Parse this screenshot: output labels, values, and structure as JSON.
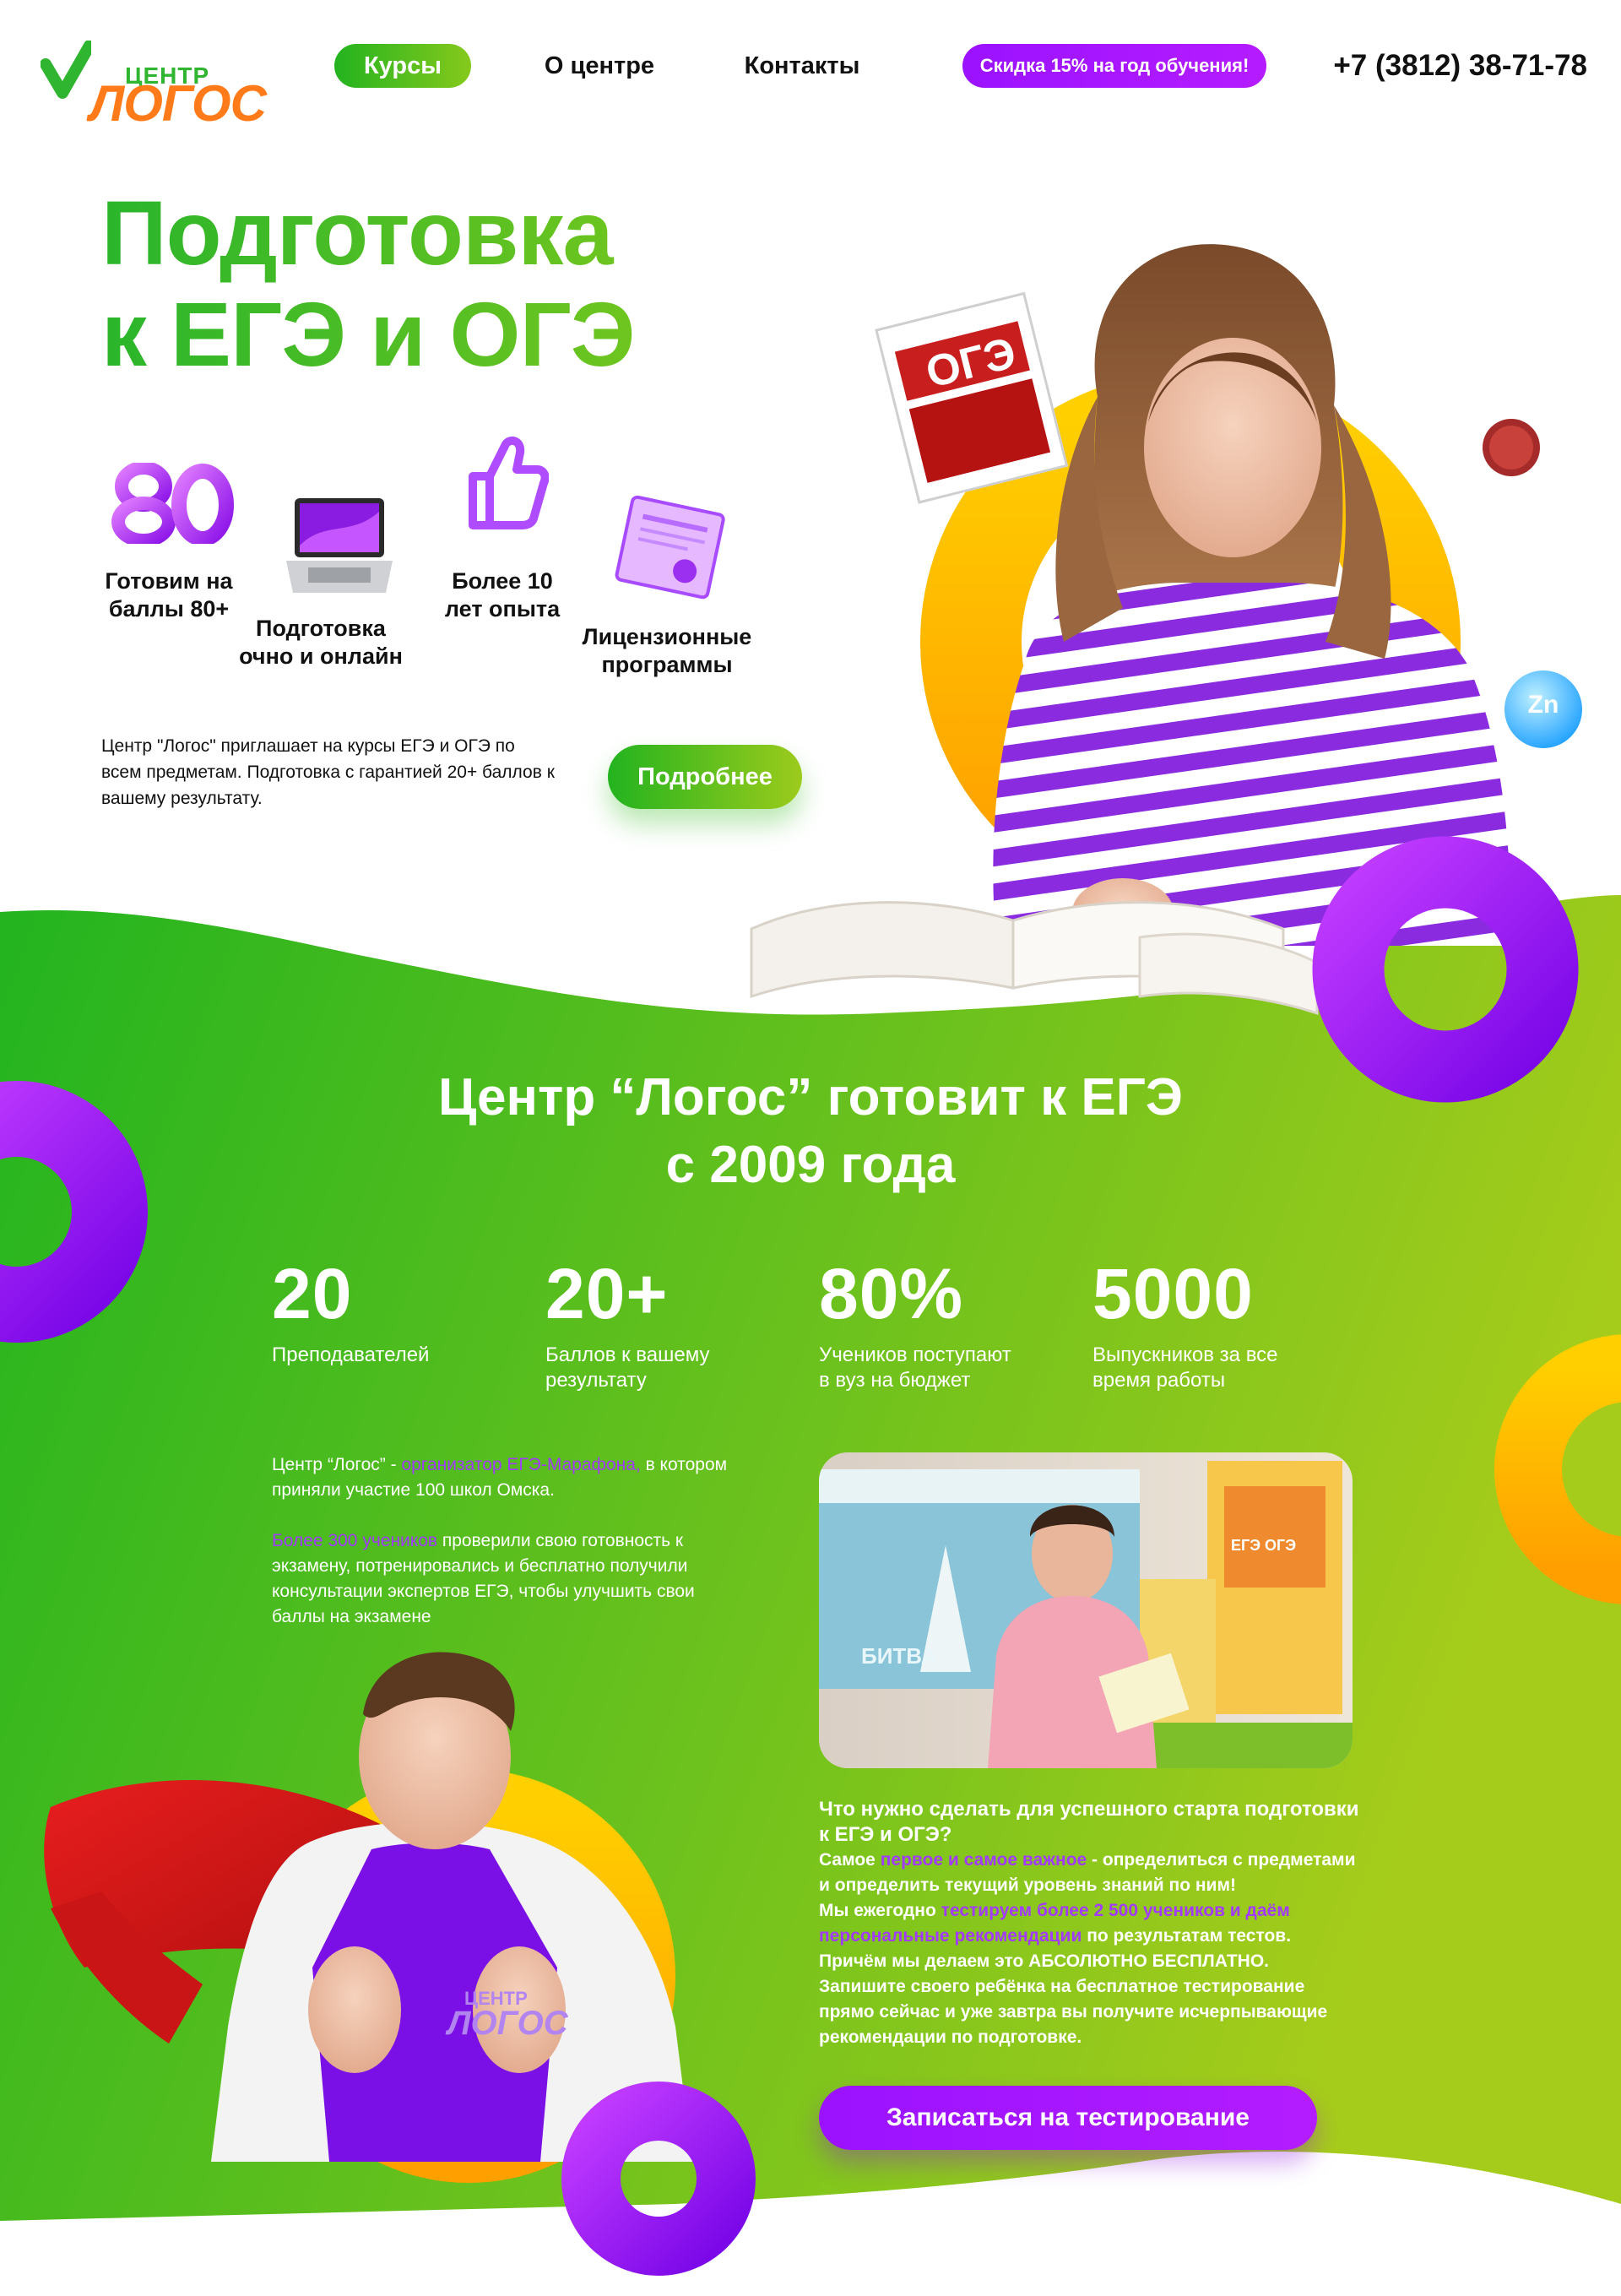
{
  "header": {
    "logo_small": "ЦЕНТР",
    "logo_big": "ЛОГОС",
    "nav": [
      {
        "label": "Курсы"
      },
      {
        "label": "О центре"
      },
      {
        "label": "Контакты"
      }
    ],
    "promo": "Скидка 15% на год обучения!",
    "phone": "+7 (3812) 38-71-78"
  },
  "hero": {
    "title_line1": "Подготовка",
    "title_line2": "к ЕГЭ и ОГЭ",
    "features": [
      {
        "icon": "score-80-icon",
        "text_l1": "Готовим на",
        "text_l2": "баллы 80+"
      },
      {
        "icon": "laptop-icon",
        "text_l1": "Подготовка",
        "text_l2": "очно и онлайн"
      },
      {
        "icon": "thumbs-up-icon",
        "text_l1": "Более 10",
        "text_l2": "лет опыта"
      },
      {
        "icon": "certificate-icon",
        "text_l1": "Лицензионные",
        "text_l2": "программы"
      }
    ],
    "description": "Центр \"Логос\" приглашает на курсы ЕГЭ и ОГЭ по всем предметам. Подготовка с гарантией 20+ баллов к вашему результату.",
    "more_button": "Подробнее",
    "book_label": "ОГЭ",
    "zn_label": "Zn"
  },
  "section": {
    "title_l1": "Центр “Логос” готовит к ЕГЭ",
    "title_l2": "с 2009 года",
    "stats": [
      {
        "num": "20",
        "l1": "Преподавателей",
        "l2": ""
      },
      {
        "num": "20+",
        "l1": "Баллов к вашему",
        "l2": "результату"
      },
      {
        "num": "80%",
        "l1": "Учеников поступают",
        "l2": "в вуз на бюджет"
      },
      {
        "num": "5000",
        "l1": "Выпускников за все",
        "l2": "время работы"
      }
    ],
    "para1_a": "Центр “Логос” - ",
    "para1_hl": "организатор ЕГЭ-Марафона,",
    "para1_b": " в котором приняли участие 100 школ Омска.",
    "para2_hl": "Более 300 учеников",
    "para2_b": " проверили свою готовность к экзамену, потренировались и бесплатно получили консультации экспертов ЕГЭ, чтобы улучшить свои баллы на экзамене",
    "q_title": "Что нужно сделать для успешного старта подготовки к ЕГЭ и ОГЭ?",
    "q1_a": "Самое ",
    "q1_hl": "первое и самое важное",
    "q1_b": " - определиться с предметами и определить текущий уровень знаний по ним!",
    "q2_a": "Мы ежегодно ",
    "q2_hl": "тестируем более 2 500 учеников и даём персональные рекомендации",
    "q2_b": " по результатам тестов.",
    "q3": "Причём мы делаем это АБСОЛЮТНО БЕСПЛАТНО.",
    "q4": "Запишите своего ребёнка на бесплатное тестирование прямо сейчас и уже завтра вы получите исчерпывающие рекомендации по подготовке.",
    "test_button": "Записаться на тестирование",
    "photo_poster_1": "БИТВА",
    "photo_poster_2": "ЕГЭ ОГЭ",
    "shirt_small": "ЦЕНТР",
    "shirt_big": "ЛОГОС"
  },
  "colors": {
    "green_start": "#23b31f",
    "green_end": "#9ccb1c",
    "purple": "#9b12ff",
    "orange": "#ff7b1a",
    "yellow": "#ffc400"
  }
}
